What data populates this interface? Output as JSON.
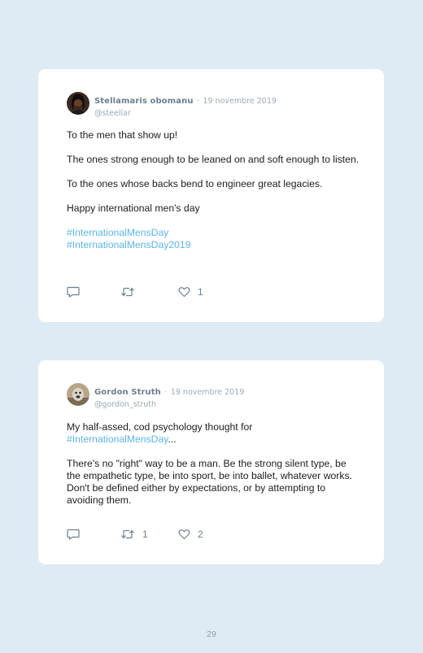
{
  "tweets": [
    {
      "author": "Stellamaris obomanu",
      "date_sep": "·",
      "date": "19 novembre 2019",
      "handle": "@steellar",
      "paragraphs": [
        "To the men that show up!",
        "The ones strong enough to be leaned on and soft enough to listen.",
        "To the ones whose backs bend to engineer great legacies.",
        "Happy international men's day"
      ],
      "hashtags": [
        "#InternationalMensDay",
        "#InternationalMensDay2019"
      ],
      "retweets": "",
      "likes": "1"
    },
    {
      "author": "Gordon Struth",
      "date_sep": "·",
      "date": "19 novembre 2019",
      "handle": "@gordon_struth",
      "intro": "My half-assed, cod psychology thought for",
      "intro_hashtag": "#InternationalMensDay",
      "intro_suffix": "...",
      "paragraph": "There's no \"right\" way to be a man. Be the strong silent type, be the empathetic type, be into sport, be into ballet, whatever works. Don't be defined either by expectations, or by attempting to avoiding them.",
      "retweets": "1",
      "likes": "2"
    }
  ],
  "icons": {
    "reply": "comment-icon",
    "retweet": "retweet-icon",
    "like": "heart-icon"
  },
  "colors": {
    "page_bg": "#deebf4",
    "card_bg": "#ffffff",
    "hashtag": "#5bb6e8",
    "meta": "#9aabb8"
  },
  "page_number": "29"
}
